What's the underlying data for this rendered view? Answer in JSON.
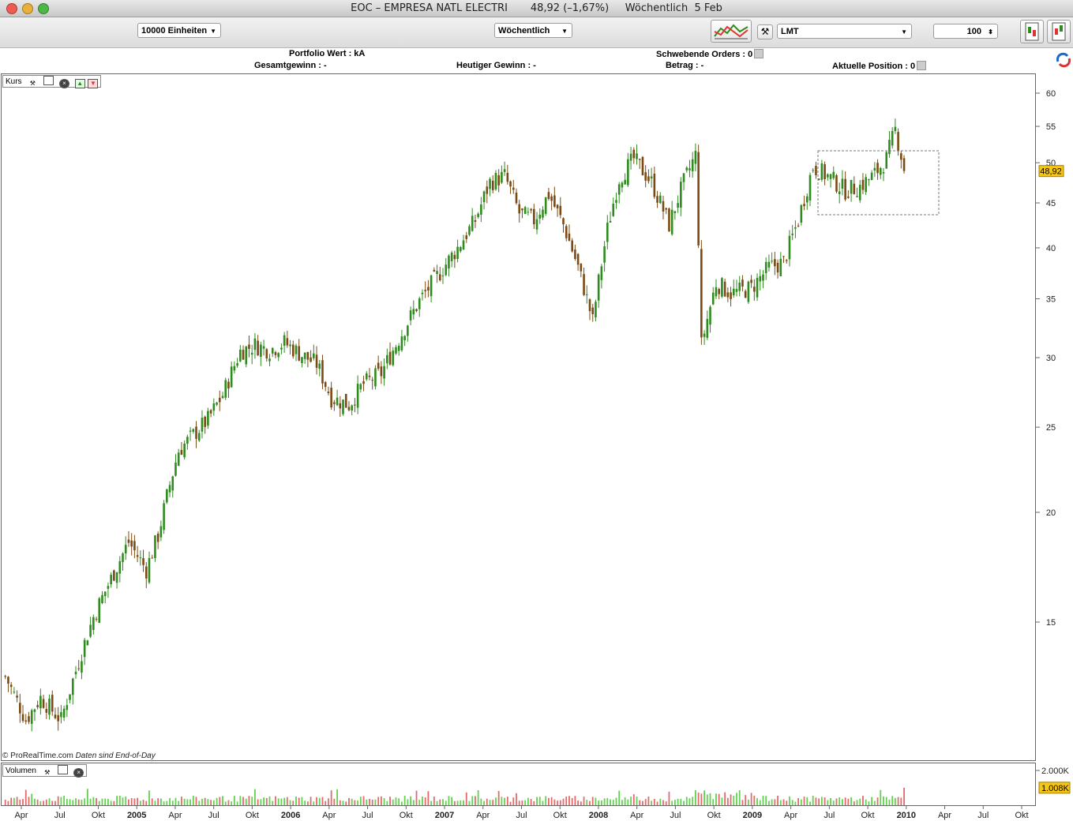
{
  "window": {
    "title": "EOC – EMPRESA NATL ELECTRI       48,92 (–1,67%)     Wöchentlich  5 Feb"
  },
  "toolbar": {
    "units_select": "10000 Einheiten",
    "period_select": "Wöchentlich",
    "symbol_select": "LMT",
    "quantity_value": "100"
  },
  "info": {
    "portfolio_value": "Portfolio Wert : kA",
    "pending_orders": "Schwebende Orders : 0",
    "total_gain": "Gesamtgewinn : -",
    "today_gain": "Heutiger Gewinn : -",
    "amount": "Betrag : -",
    "current_position": "Aktuelle Position : 0"
  },
  "price_panel": {
    "label": "Kurs"
  },
  "volume_panel": {
    "label": "Volumen"
  },
  "copyright": {
    "source": "© ProRealTime.com",
    "note": "Daten sind End-of-Day"
  },
  "colors": {
    "up": "#2e8b1e",
    "down": "#7a4a12",
    "vol_up": "#62d24e",
    "vol_down": "#e36a6a",
    "last_price_bg": "#f5c518"
  },
  "chart_data": {
    "type": "candlestick",
    "symbol": "EOC",
    "interval": "Wöchentlich",
    "last_price": "48,92",
    "last_volume": "1.008K",
    "y_scale": "log",
    "ylim": [
      11.0,
      62.0
    ],
    "y_ticks": [
      15,
      20,
      25,
      30,
      35,
      40,
      45,
      50,
      55,
      60
    ],
    "vol_ticks": [
      "2.000K",
      "1.008K"
    ],
    "x_ticks": [
      "Apr",
      "Jul",
      "Okt",
      "2005",
      "Apr",
      "Jul",
      "Okt",
      "2006",
      "Apr",
      "Jul",
      "Okt",
      "2007",
      "Apr",
      "Jul",
      "Okt",
      "2008",
      "Apr",
      "Jul",
      "Okt",
      "2009",
      "Apr",
      "Jul",
      "Okt",
      "2010",
      "Apr",
      "Jul",
      "Okt"
    ],
    "price_path": [
      [
        "2004-03-26",
        13.0
      ],
      [
        "2004-05-14",
        11.6
      ],
      [
        "2004-06-18",
        12.3
      ],
      [
        "2004-08-06",
        11.6
      ],
      [
        "2004-09-10",
        13.2
      ],
      [
        "2004-10-22",
        15.2
      ],
      [
        "2004-12-03",
        16.8
      ],
      [
        "2005-01-14",
        18.5
      ],
      [
        "2005-02-25",
        17.2
      ],
      [
        "2005-03-25",
        18.8
      ],
      [
        "2005-04-22",
        21.5
      ],
      [
        "2005-05-13",
        23.5
      ],
      [
        "2005-06-17",
        24.5
      ],
      [
        "2005-07-22",
        25.5
      ],
      [
        "2005-08-26",
        27.2
      ],
      [
        "2005-10-07",
        30.5
      ],
      [
        "2005-11-11",
        31.0
      ],
      [
        "2005-12-16",
        30.6
      ],
      [
        "2006-01-20",
        31.2
      ],
      [
        "2006-03-03",
        30.2
      ],
      [
        "2006-04-07",
        29.5
      ],
      [
        "2006-05-12",
        27.0
      ],
      [
        "2006-06-23",
        26.5
      ],
      [
        "2006-07-28",
        28.0
      ],
      [
        "2006-09-08",
        28.8
      ],
      [
        "2006-10-20",
        31.5
      ],
      [
        "2006-12-08",
        34.8
      ],
      [
        "2007-01-26",
        37.5
      ],
      [
        "2007-03-09",
        40.0
      ],
      [
        "2007-04-20",
        43.0
      ],
      [
        "2007-05-25",
        47.5
      ],
      [
        "2007-06-29",
        48.3
      ],
      [
        "2007-08-03",
        43.8
      ],
      [
        "2007-09-07",
        43.0
      ],
      [
        "2007-10-12",
        46.0
      ],
      [
        "2007-11-16",
        42.5
      ],
      [
        "2007-12-21",
        38.0
      ],
      [
        "2008-01-25",
        33.0
      ],
      [
        "2008-02-29",
        42.0
      ],
      [
        "2008-03-28",
        48.0
      ],
      [
        "2008-05-02",
        50.5
      ],
      [
        "2008-06-13",
        47.5
      ],
      [
        "2008-07-25",
        42.5
      ],
      [
        "2008-08-29",
        47.5
      ],
      [
        "2008-09-26",
        51.0
      ],
      [
        "2008-10-10",
        31.0
      ],
      [
        "2008-11-14",
        36.5
      ],
      [
        "2008-12-19",
        35.5
      ],
      [
        "2009-02-06",
        36.0
      ],
      [
        "2009-03-20",
        38.0
      ],
      [
        "2009-04-24",
        38.5
      ],
      [
        "2009-05-29",
        43.0
      ],
      [
        "2009-07-03",
        49.5
      ],
      [
        "2009-08-14",
        48.0
      ],
      [
        "2009-09-18",
        46.5
      ],
      [
        "2009-10-23",
        47.0
      ],
      [
        "2009-11-27",
        48.5
      ],
      [
        "2009-12-25",
        50.5
      ],
      [
        "2010-01-15",
        54.5
      ],
      [
        "2010-01-29",
        51.0
      ],
      [
        "2010-02-05",
        48.92
      ]
    ]
  }
}
